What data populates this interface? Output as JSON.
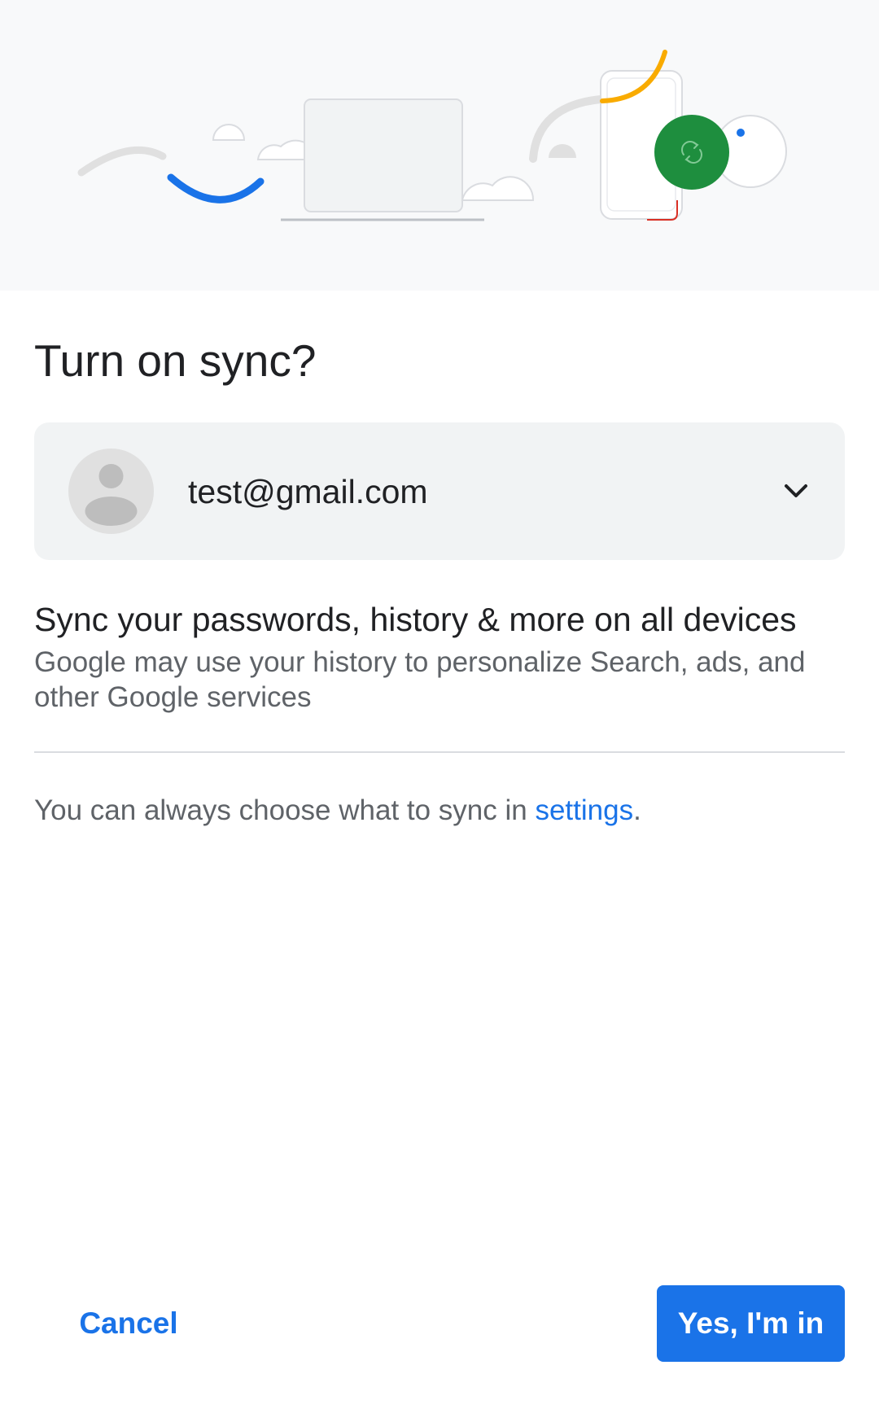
{
  "dialog": {
    "title": "Turn on sync?",
    "account": {
      "email": "test@gmail.com",
      "avatar_icon": "person-icon",
      "expand_icon": "chevron-down-icon"
    },
    "sync": {
      "heading": "Sync your passwords, history & more on all devices",
      "description": "Google may use your history to personalize Search, ads, and other Google services"
    },
    "settings_note": {
      "prefix": "You can always choose what to sync in ",
      "link_label": "settings",
      "suffix": "."
    }
  },
  "actions": {
    "cancel_label": "Cancel",
    "confirm_label": "Yes, I'm in"
  },
  "colors": {
    "accent": "#1a73e8",
    "sync_green": "#1e8e3e",
    "illustration_yellow": "#f9ab00",
    "illustration_red": "#d93025",
    "hero_background": "#f8f9fa",
    "card_background": "#f1f3f4"
  },
  "illustration": {
    "sync_icon": "sync-icon"
  }
}
